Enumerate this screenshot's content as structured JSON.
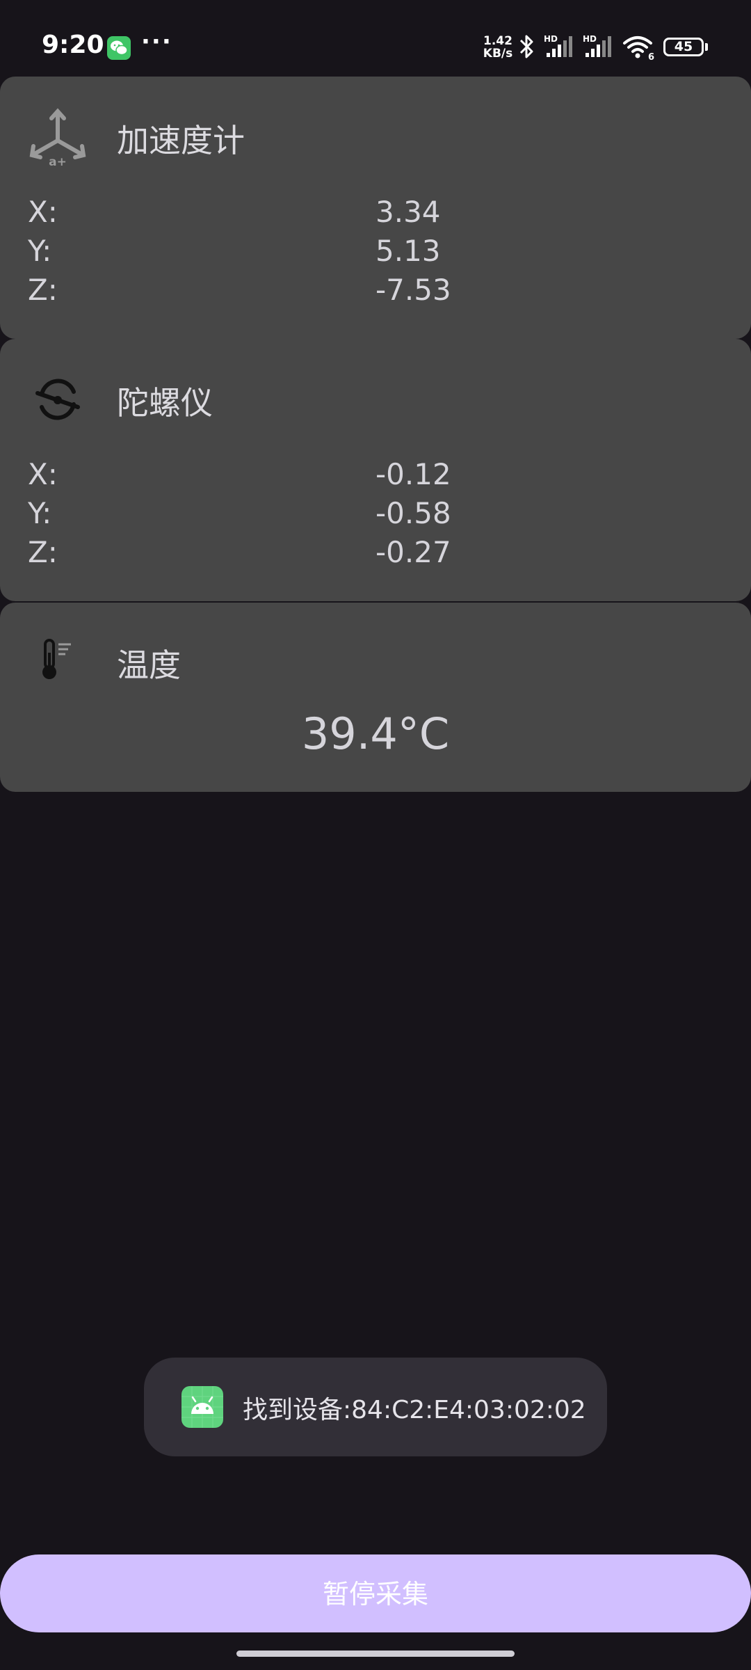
{
  "status_bar": {
    "time": "9:20",
    "more": "···",
    "net_speed_value": "1.42",
    "net_speed_unit": "KB/s",
    "signal_1_badge": "HD",
    "signal_2_badge": "HD",
    "wifi_badge": "6",
    "battery": "45",
    "icons": [
      "wechat-icon",
      "bluetooth-icon",
      "signal-icon",
      "signal-icon",
      "wifi-icon",
      "battery-icon"
    ]
  },
  "accelerometer": {
    "title": "加速度计",
    "icon": "accelerometer-icon",
    "icon_text": "a+",
    "rows": [
      {
        "label": "X:",
        "value": "3.34"
      },
      {
        "label": "Y:",
        "value": "5.13"
      },
      {
        "label": "Z:",
        "value": "-7.53"
      }
    ]
  },
  "gyroscope": {
    "title": "陀螺仪",
    "icon": "gyroscope-icon",
    "rows": [
      {
        "label": "X:",
        "value": "-0.12"
      },
      {
        "label": "Y:",
        "value": "-0.58"
      },
      {
        "label": "Z:",
        "value": "-0.27"
      }
    ]
  },
  "temperature": {
    "title": "温度",
    "icon": "thermometer-icon",
    "value": "39.4°C"
  },
  "toast": {
    "icon": "android-icon",
    "text": "找到设备:84:C2:E4:03:02:02"
  },
  "actions": {
    "pause_label": "暂停采集"
  },
  "colors": {
    "background": "#17141a",
    "card": "#474747",
    "button": "#d1bfff",
    "toast": "#322f37"
  }
}
